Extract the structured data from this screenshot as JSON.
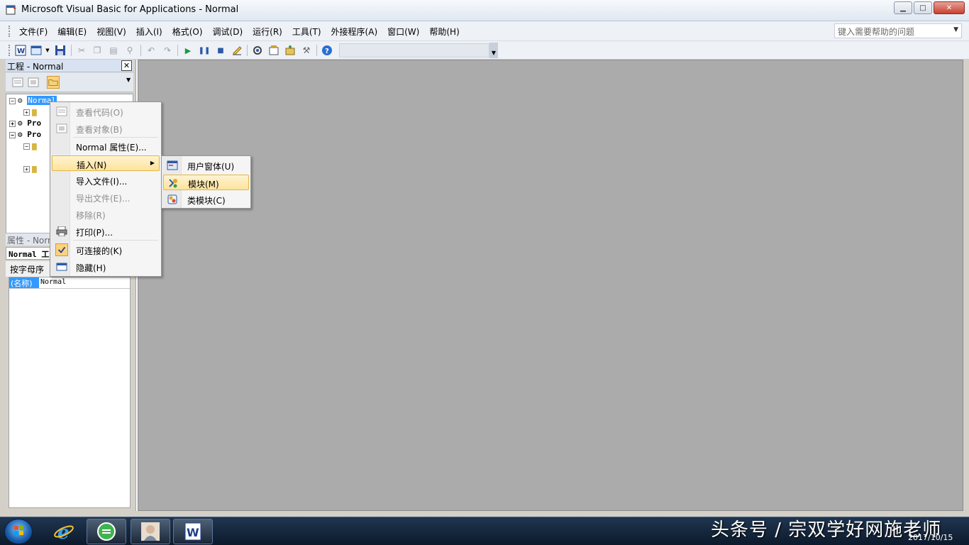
{
  "window": {
    "title": "Microsoft Visual Basic for Applications - Normal",
    "minimize": "▁",
    "maximize": "□",
    "close": "✕"
  },
  "menubar": {
    "items": [
      "文件(F)",
      "编辑(E)",
      "视图(V)",
      "插入(I)",
      "格式(O)",
      "调试(D)",
      "运行(R)",
      "工具(T)",
      "外接程序(A)",
      "窗口(W)",
      "帮助(H)"
    ],
    "help_placeholder": "键入需要帮助的问题"
  },
  "project_pane": {
    "title": "工程 - Normal",
    "tree": [
      {
        "name": "Normal",
        "selected": true
      },
      {
        "name": "Pro"
      },
      {
        "name": "Pro"
      }
    ]
  },
  "properties_pane": {
    "title": "属性 - Norm",
    "object": "Normal 工",
    "tab": "按字母序",
    "row_key": "(名称)",
    "row_value": "Normal"
  },
  "context_menu": {
    "items": [
      {
        "label": "查看代码(O)",
        "disabled": true,
        "icon": "view-code-icon"
      },
      {
        "label": "查看对象(B)",
        "disabled": true,
        "icon": "view-object-icon"
      },
      {
        "label": "Normal 属性(E)...",
        "disabled": false
      },
      {
        "label": "插入(N)",
        "disabled": false,
        "highlighted": true,
        "submenu": true
      },
      {
        "label": "导入文件(I)...",
        "disabled": false
      },
      {
        "label": "导出文件(E)...",
        "disabled": true
      },
      {
        "label": "移除(R)",
        "disabled": true
      },
      {
        "label": "打印(P)...",
        "disabled": false,
        "icon": "printer-icon"
      },
      {
        "label": "可连接的(K)",
        "disabled": false,
        "checked": true
      },
      {
        "label": "隐藏(H)",
        "disabled": false,
        "icon": "hide-window-icon"
      }
    ]
  },
  "submenu": {
    "items": [
      {
        "label": "用户窗体(U)",
        "icon": "userform-icon"
      },
      {
        "label": "模块(M)",
        "icon": "module-icon",
        "highlighted": true
      },
      {
        "label": "类模块(C)",
        "icon": "class-module-icon"
      }
    ]
  },
  "taskbar": {
    "watermark": "头条号 / 宗双学好网施老师",
    "date": "2017/10/15"
  },
  "colors": {
    "mdi_background": "#ababab",
    "highlight": "#fde39c",
    "selection": "#3399ff"
  }
}
